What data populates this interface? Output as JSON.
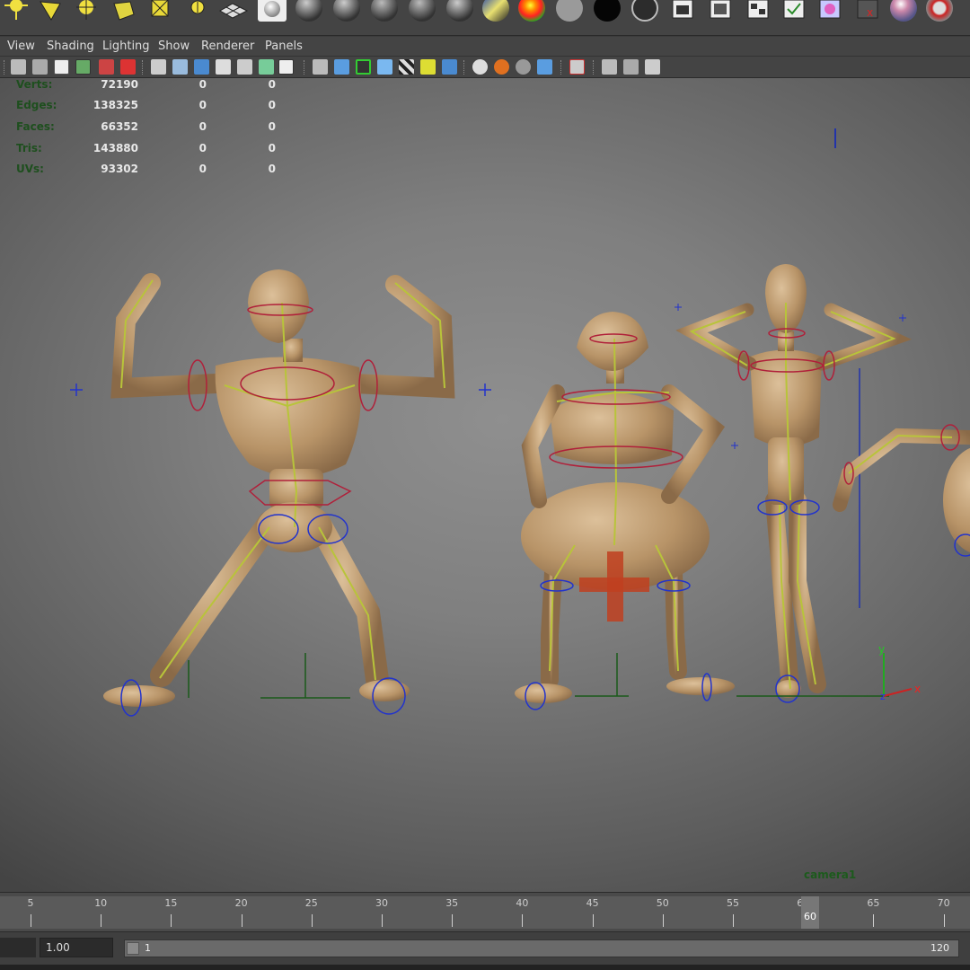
{
  "menu": [
    "View",
    "Shading",
    "Lighting",
    "Show",
    "Renderer",
    "Panels"
  ],
  "hud": {
    "rows": [
      {
        "label": "Verts:",
        "values": [
          "72190",
          "0",
          "0"
        ]
      },
      {
        "label": "Edges:",
        "values": [
          "138325",
          "0",
          "0"
        ]
      },
      {
        "label": "Faces:",
        "values": [
          "66352",
          "0",
          "0"
        ]
      },
      {
        "label": "Tris:",
        "values": [
          "143880",
          "0",
          "0"
        ]
      },
      {
        "label": "UVs:",
        "values": [
          "93302",
          "0",
          "0"
        ]
      }
    ]
  },
  "camera": "camera1",
  "timeline": {
    "ticks": [
      "5",
      "10",
      "15",
      "20",
      "25",
      "30",
      "35",
      "40",
      "45",
      "50",
      "55",
      "60",
      "65",
      "70"
    ],
    "current_frame": "60"
  },
  "range": {
    "start": "1.00",
    "min": "1",
    "max": "120"
  },
  "colors": {
    "mannequin": "#c7a47c",
    "joint": "#b8c43a",
    "control": "#b0203a",
    "locator": "#2233cc",
    "hud_label": "#1e4f1e"
  }
}
